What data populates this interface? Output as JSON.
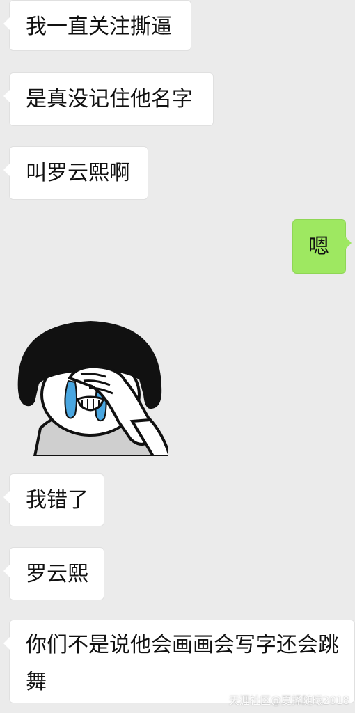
{
  "chat": {
    "messages": [
      {
        "side": "left",
        "text": "我一直关注撕逼"
      },
      {
        "side": "left",
        "text": "是真没记住他名字"
      },
      {
        "side": "left",
        "text": "叫罗云熙啊"
      },
      {
        "side": "right",
        "text": "嗯"
      },
      {
        "side": "left",
        "type": "sticker",
        "sticker_icon": "crying-mushroom-head-sticker-icon"
      },
      {
        "side": "left",
        "text": "我错了"
      },
      {
        "side": "left",
        "text": "罗云熙"
      },
      {
        "side": "left",
        "text": "你们不是说他会画画会写字还会跳舞"
      }
    ]
  },
  "watermark": {
    "text": "天涯社区@夏择随曦2018"
  },
  "colors": {
    "background": "#ebebeb",
    "bubble_left": "#ffffff",
    "bubble_right": "#9ee861"
  }
}
